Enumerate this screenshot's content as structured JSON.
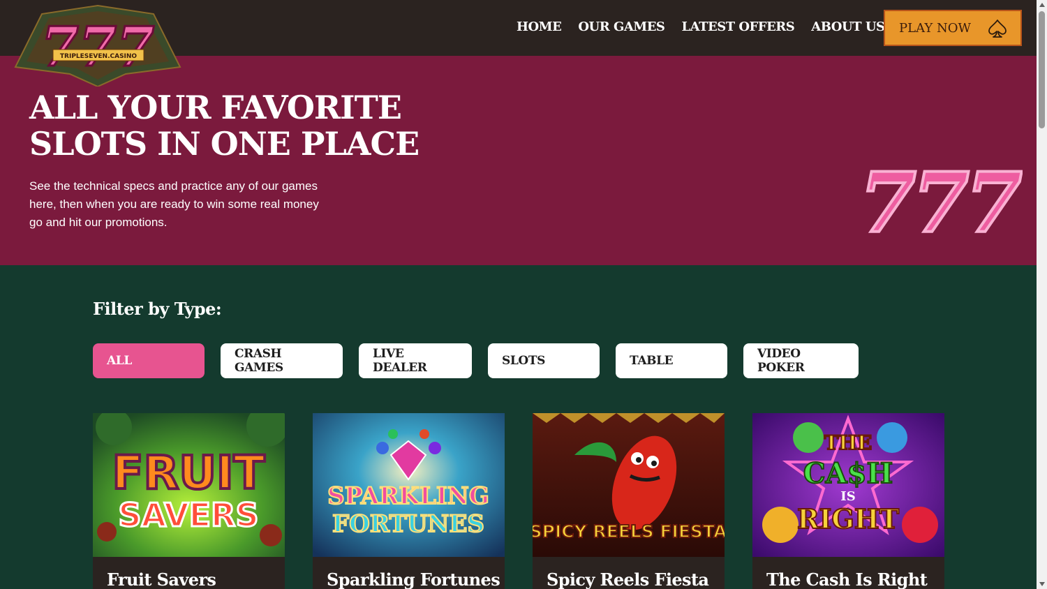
{
  "header": {
    "logo_text": "TRIPLESEVEN.CASINO",
    "nav": [
      "HOME",
      "OUR GAMES",
      "LATEST OFFERS",
      "ABOUT US"
    ],
    "play_now": "PLAY NOW"
  },
  "hero": {
    "title": "ALL YOUR FAVORITE SLOTS IN ONE PLACE",
    "text": "See the technical specs and practice any of our games here, then when you are ready to win some real money go and hit our promotions."
  },
  "filter": {
    "title": "Filter by Type:",
    "options": [
      "ALL",
      "CRASH GAMES",
      "LIVE DEALER",
      "SLOTS",
      "TABLE",
      "VIDEO POKER"
    ],
    "active": "ALL"
  },
  "games": [
    {
      "title": "Fruit Savers",
      "art": [
        "FRUIT",
        "SAVERS"
      ]
    },
    {
      "title": "Sparkling Fortunes",
      "art": [
        "SPARKLING",
        "FORTUNES"
      ]
    },
    {
      "title": "Spicy Reels Fiesta",
      "art": [
        "SPICY REELS FIESTA"
      ]
    },
    {
      "title": "The Cash Is Right",
      "art": [
        "THE",
        "CA$H",
        "IS",
        "RIGHT"
      ]
    }
  ],
  "colors": {
    "header_bg": "#2b2320",
    "hero_bg": "#7b1a3d",
    "page_bg": "#143a2e",
    "accent_pink": "#e75490",
    "play_orange": "#e8962a"
  }
}
